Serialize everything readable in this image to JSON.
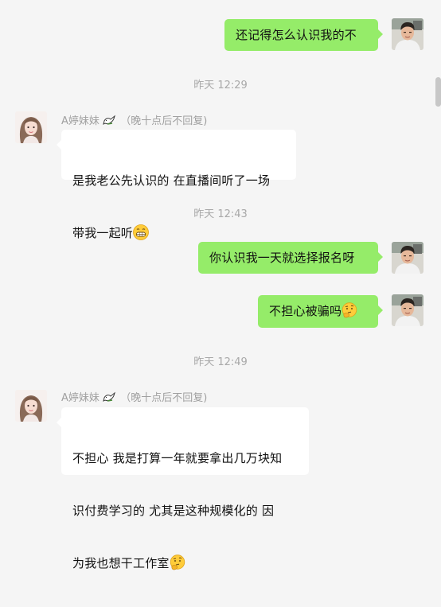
{
  "messages": {
    "m1": {
      "text": "还记得怎么认识我的不"
    },
    "t1": {
      "text": "昨天 12:29"
    },
    "m2": {
      "sender": "A婷妹妹",
      "sender_note": "（晚十点后不回复)",
      "line1": "是我老公先认识的 在直播间听了一场",
      "line2": "带我一起听"
    },
    "t2": {
      "text": "昨天 12:43"
    },
    "m3": {
      "text": "你认识我一天就选择报名呀"
    },
    "m4": {
      "text": "不担心被骗吗"
    },
    "t3": {
      "text": "昨天 12:49"
    },
    "m5": {
      "sender": "A婷妹妹",
      "sender_note": "（晚十点后不回复)",
      "line1": "不担心 我是打算一年就要拿出几万块知",
      "line2": "识付费学习的 尤其是这种规模化的 因",
      "line3": "为我也想干工作室"
    }
  },
  "colors": {
    "self_bubble": "#95ec69",
    "other_bubble": "#ffffff",
    "background": "#f5f5f5"
  },
  "icons": {
    "dove": "dove-icon",
    "grin_emoji": "grinning-emoji",
    "thinking_emoji": "thinking-emoji"
  }
}
